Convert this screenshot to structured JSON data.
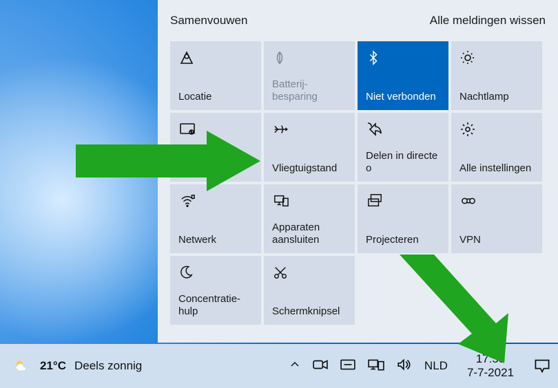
{
  "panel": {
    "collapse_label": "Samenvouwen",
    "clear_label": "Alle meldingen wissen"
  },
  "tiles": {
    "location": {
      "label": "Locatie"
    },
    "battery": {
      "label": "Batterij-besparing"
    },
    "bluetooth": {
      "label": "Niet verbonden"
    },
    "nightlight": {
      "label": "Nachtlamp"
    },
    "tablet": {
      "label": "Tabletmodus"
    },
    "airplane": {
      "label": "Vliegtuigstand"
    },
    "nearby": {
      "label": "Delen in directe o"
    },
    "settings": {
      "label": "Alle instellingen"
    },
    "network": {
      "label": "Netwerk"
    },
    "connect": {
      "label": "Apparaten aansluiten"
    },
    "project": {
      "label": "Projecteren"
    },
    "vpn": {
      "label": "VPN"
    },
    "focus": {
      "label": "Concentratie-hulp"
    },
    "snip": {
      "label": "Schermknipsel"
    }
  },
  "weather": {
    "temp": "21°C",
    "desc": "Deels zonnig"
  },
  "tray": {
    "lang": "NLD"
  },
  "clock": {
    "time": "17:55",
    "date": "7-7-2021"
  }
}
